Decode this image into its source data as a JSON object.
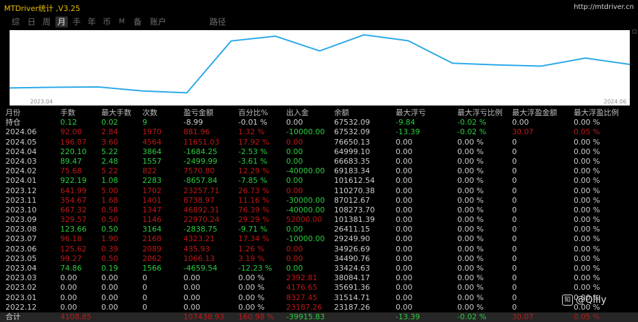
{
  "title": "MTDriver统计 ,V3.25",
  "url": "http://mtdriver.cn",
  "tabs": [
    "综",
    "日",
    "周",
    "月",
    "手",
    "年",
    "币",
    "M",
    "备",
    "账户",
    "路径"
  ],
  "active_tab": "月",
  "colors": {
    "accent": "#29a8e8",
    "title": "#e8c000",
    "positive": "#2ecc40",
    "negative": "#c01818",
    "neutral": "#cfcfcf"
  },
  "chart_data": {
    "type": "line",
    "x": [
      "2023.04",
      "2023.05",
      "2023.06",
      "2023.07",
      "2023.08",
      "2023.09",
      "2023.10",
      "2023.11",
      "2023.12",
      "2024.01",
      "2024.02",
      "2024.03",
      "2024.04",
      "2024.05",
      "2024.06"
    ],
    "values": [
      33424.63,
      34490.76,
      34926.69,
      29249.9,
      26411.15,
      101381.39,
      108273.7,
      87012.67,
      110270.38,
      101612.54,
      69183.34,
      66683.35,
      64999.1,
      76650.13,
      67532.09
    ],
    "xlabel_start": "2023.04",
    "xlabel_end": "2024.06",
    "color": "#29a8e8"
  },
  "table": {
    "headers": [
      "月份",
      "手数",
      "最大手数",
      "次数",
      "盈亏金额",
      "百分比%",
      "出入金",
      "余额",
      "最大浮亏",
      "最大浮亏比例",
      "最大浮盈金额",
      "最大浮盈比例"
    ],
    "hold": [
      "持仓",
      "0.12",
      "0.02",
      "9",
      "-8.99",
      "-0.01 %",
      "0.00",
      "67532.09",
      "-9.84",
      "-0.02 %",
      "0.00",
      "0.00 %"
    ],
    "rows": [
      [
        "2024.06",
        "92.08",
        "2.84",
        "1970",
        "881.96",
        "1.32 %",
        "-10000.00",
        "67532.09",
        "-13.39",
        "-0.02 %",
        "30.07",
        "0.05 %"
      ],
      [
        "2024.05",
        "196.07",
        "3.60",
        "4564",
        "11651.03",
        "17.92 %",
        "0.00",
        "76650.13",
        "0.00",
        "0.00 %",
        "0",
        "0.00 %"
      ],
      [
        "2024.04",
        "220.10",
        "5.22",
        "3864",
        "-1684.25",
        "-2.53 %",
        "0.00",
        "64999.10",
        "0.00",
        "0.00 %",
        "0",
        "0.00 %"
      ],
      [
        "2024.03",
        "89.47",
        "2.48",
        "1557",
        "-2499.99",
        "-3.61 %",
        "0.00",
        "66683.35",
        "0.00",
        "0.00 %",
        "0",
        "0.00 %"
      ],
      [
        "2024.02",
        "75.68",
        "5.22",
        "822",
        "7570.80",
        "12.29 %",
        "-40000.00",
        "69183.34",
        "0.00",
        "0.00 %",
        "0",
        "0.00 %"
      ],
      [
        "2024.01",
        "922.19",
        "1.08",
        "2283",
        "-8657.84",
        "-7.85 %",
        "0.00",
        "101612.54",
        "0.00",
        "0.00 %",
        "0",
        "0.00 %"
      ],
      [
        "2023.12",
        "641.99",
        "5.00",
        "1702",
        "23257.71",
        "26.73 %",
        "0.00",
        "110270.38",
        "0.00",
        "0.00 %",
        "0",
        "0.00 %"
      ],
      [
        "2023.11",
        "354.67",
        "1.68",
        "1401",
        "8738.97",
        "11.16 %",
        "-30000.00",
        "87012.67",
        "0.00",
        "0.00 %",
        "0",
        "0.00 %"
      ],
      [
        "2023.10",
        "667.32",
        "0.58",
        "1347",
        "46892.31",
        "76.39 %",
        "-40000.00",
        "108273.70",
        "0.00",
        "0.00 %",
        "0",
        "0.00 %"
      ],
      [
        "2023.09",
        "329.57",
        "0.50",
        "1146",
        "22970.24",
        "29.29 %",
        "52000.00",
        "101381.39",
        "0.00",
        "0.00 %",
        "0",
        "0.00 %"
      ],
      [
        "2023.08",
        "123.66",
        "0.50",
        "3164",
        "-2838.75",
        "-9.71 %",
        "0.00",
        "26411.15",
        "0.00",
        "0.00 %",
        "0",
        "0.00 %"
      ],
      [
        "2023.07",
        "96.18",
        "1.90",
        "2168",
        "4323.21",
        "17.34 %",
        "-10000.00",
        "29249.90",
        "0.00",
        "0.00 %",
        "0",
        "0.00 %"
      ],
      [
        "2023.06",
        "125.62",
        "0.39",
        "2089",
        "435.93",
        "1.26 %",
        "0.00",
        "34926.69",
        "0.00",
        "0.00 %",
        "0",
        "0.00 %"
      ],
      [
        "2023.05",
        "99.27",
        "0.50",
        "2062",
        "1066.13",
        "3.19 %",
        "0.00",
        "34490.76",
        "0.00",
        "0.00 %",
        "0",
        "0.00 %"
      ],
      [
        "2023.04",
        "74.86",
        "0.19",
        "1566",
        "-4659.54",
        "-12.23 %",
        "0.00",
        "33424.63",
        "0.00",
        "0.00 %",
        "0",
        "0.00 %"
      ],
      [
        "2023.03",
        "0.00",
        "0.00",
        "0",
        "0.00",
        "0.00 %",
        "2392.81",
        "38084.17",
        "0.00",
        "0.00 %",
        "0",
        "0.00 %"
      ],
      [
        "2023.02",
        "0.00",
        "0.00",
        "0",
        "0.00",
        "0.00 %",
        "4176.65",
        "35691.36",
        "0.00",
        "0.00 %",
        "0",
        "0.00 %"
      ],
      [
        "2023.01",
        "0.00",
        "0.00",
        "0",
        "0.00",
        "0.00 %",
        "8327.45",
        "31514.71",
        "0.00",
        "0.00 %",
        "0",
        "0.00 %"
      ],
      [
        "2022.12",
        "0.00",
        "0.00",
        "0",
        "0.00",
        "0.00 %",
        "23187.26",
        "23187.26",
        "0.00",
        "0.00 %",
        "0",
        "0.00 %"
      ]
    ],
    "row_colors": [
      "neg",
      "neg",
      "pos",
      "pos",
      "neg",
      "pos",
      "neg",
      "neg",
      "neg",
      "neg",
      "pos",
      "neg",
      "neg",
      "neg",
      "pos",
      "neu",
      "neu",
      "neu",
      "neu"
    ],
    "total": [
      "合计",
      "4108.85",
      "",
      "",
      "107438.93",
      "160.98 %",
      "-39915.83",
      "",
      "-13.39",
      "-0.02 %",
      "30.07",
      "0.05 %"
    ]
  },
  "watermark": "@Qlily",
  "watermark_icon": "zhihu-logo-icon"
}
